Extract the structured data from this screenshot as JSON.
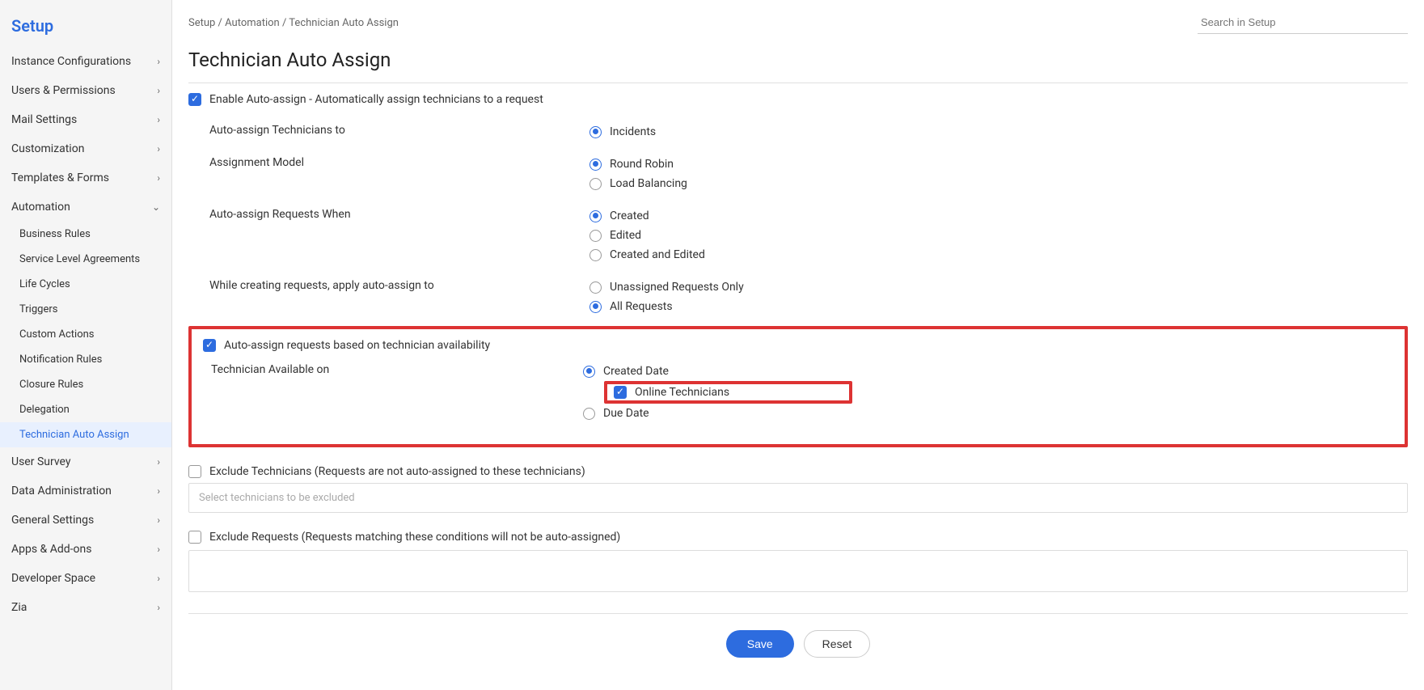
{
  "sidebar": {
    "title": "Setup",
    "items": [
      {
        "label": "Instance Configurations",
        "expanded": false
      },
      {
        "label": "Users & Permissions",
        "expanded": false
      },
      {
        "label": "Mail Settings",
        "expanded": false
      },
      {
        "label": "Customization",
        "expanded": false
      },
      {
        "label": "Templates & Forms",
        "expanded": false
      },
      {
        "label": "Automation",
        "expanded": true,
        "children": [
          {
            "label": "Business Rules"
          },
          {
            "label": "Service Level Agreements"
          },
          {
            "label": "Life Cycles"
          },
          {
            "label": "Triggers"
          },
          {
            "label": "Custom Actions"
          },
          {
            "label": "Notification Rules"
          },
          {
            "label": "Closure Rules"
          },
          {
            "label": "Delegation"
          },
          {
            "label": "Technician Auto Assign",
            "active": true
          }
        ]
      },
      {
        "label": "User Survey",
        "expanded": false
      },
      {
        "label": "Data Administration",
        "expanded": false
      },
      {
        "label": "General Settings",
        "expanded": false
      },
      {
        "label": "Apps & Add-ons",
        "expanded": false
      },
      {
        "label": "Developer Space",
        "expanded": false
      },
      {
        "label": "Zia",
        "expanded": false
      }
    ]
  },
  "breadcrumb": "Setup / Automation / Technician Auto Assign",
  "search_placeholder": "Search in Setup",
  "page_title": "Technician Auto Assign",
  "enable_label": "Enable Auto-assign - Automatically assign technicians to a request",
  "form": {
    "assign_to_label": "Auto-assign Technicians to",
    "assign_to_options": [
      "Incidents"
    ],
    "model_label": "Assignment Model",
    "model_options": [
      "Round Robin",
      "Load Balancing"
    ],
    "when_label": "Auto-assign Requests When",
    "when_options": [
      "Created",
      "Edited",
      "Created and Edited"
    ],
    "apply_label": "While creating requests, apply auto-assign to",
    "apply_options": [
      "Unassigned Requests Only",
      "All Requests"
    ],
    "availability_label": "Auto-assign requests based on technician availability",
    "available_on_label": "Technician Available on",
    "available_on_options": {
      "created": "Created Date",
      "online": "Online Technicians",
      "due": "Due Date"
    },
    "exclude_tech_label": "Exclude Technicians (Requests are not auto-assigned to these technicians)",
    "exclude_tech_placeholder": "Select technicians to be excluded",
    "exclude_req_label": "Exclude Requests (Requests matching these conditions will not be auto-assigned)"
  },
  "buttons": {
    "save": "Save",
    "reset": "Reset"
  }
}
